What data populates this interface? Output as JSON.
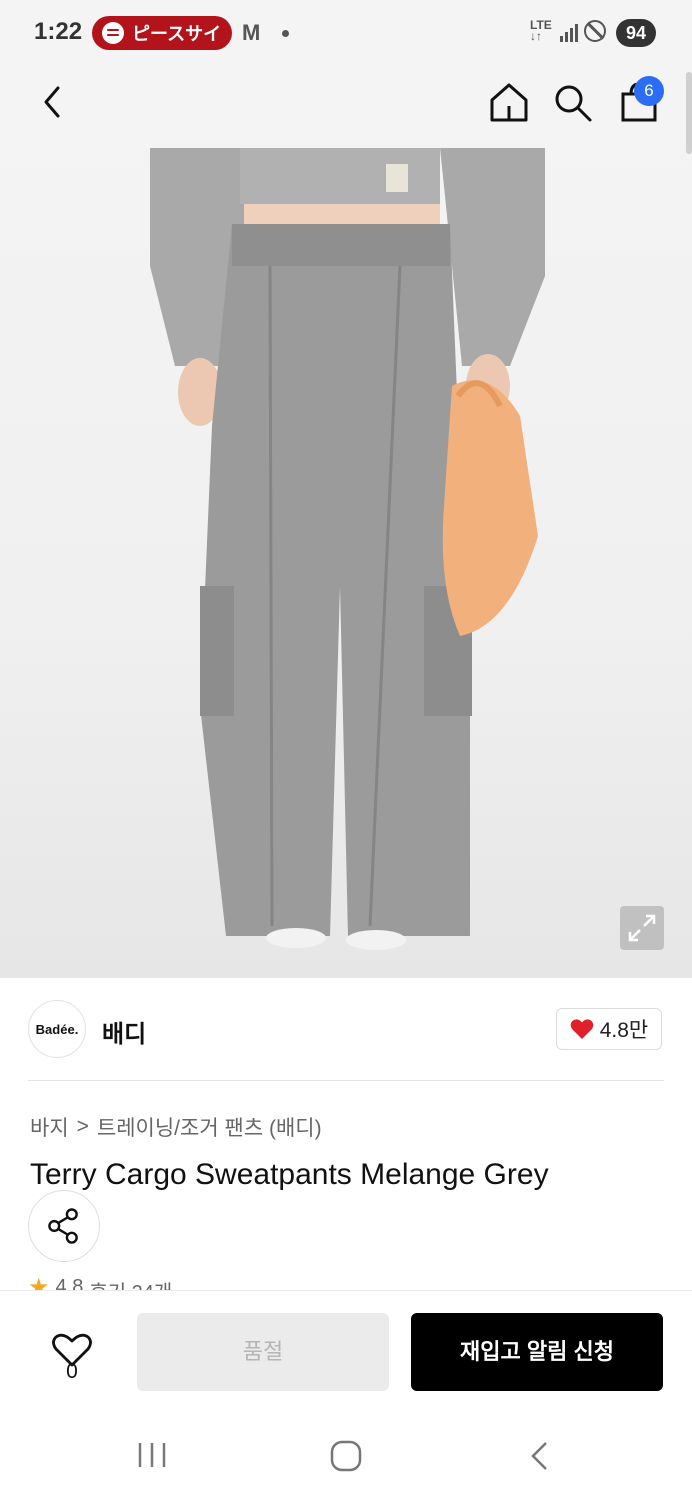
{
  "status_bar": {
    "time": "1:22",
    "spotify_text": "ピースサイ",
    "network": "LTE",
    "battery": "94"
  },
  "header": {
    "cart_count": "6"
  },
  "brand": {
    "logo_text": "Badée.",
    "name": "배디",
    "likes": "4.8만"
  },
  "breadcrumb": {
    "category": "바지",
    "separator": ">",
    "subcategory": "트레이닝/조거 팬츠 (배디)"
  },
  "product": {
    "title": "Terry Cargo Sweatpants Melange Grey",
    "rating": "4.8",
    "reviews": "후기 24개"
  },
  "action_bar": {
    "wish_count": "0",
    "soldout_label": "품절",
    "restock_label": "재입고 알림 신청"
  },
  "colors": {
    "accent_blue": "#2b6ef5",
    "heart_red": "#e0202a",
    "spotify_red": "#b3141b",
    "star": "#f5a623"
  },
  "icons": [
    "back-icon",
    "home-icon",
    "search-icon",
    "bag-icon",
    "expand-icon",
    "heart-icon",
    "share-icon",
    "star-icon",
    "recents-icon",
    "home-nav-icon",
    "back-nav-icon"
  ]
}
